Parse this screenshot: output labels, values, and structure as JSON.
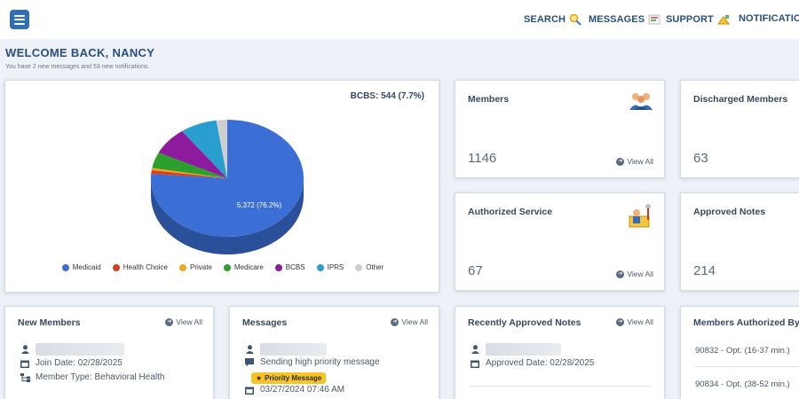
{
  "nav": {
    "search": "SEARCH",
    "messages": "MESSAGES",
    "support": "SUPPORT",
    "notifications": "NOTIFICATION"
  },
  "welcome": {
    "title": "WELCOME BACK, NANCY",
    "subtitle": "You have 2 new messages and 53 new notifications."
  },
  "chart_data": {
    "type": "pie",
    "summary": "BCBS: 544 (7.7%)",
    "slice_label": "5,372 (76.2%)",
    "categories": [
      "Medicaid",
      "Health Choice",
      "Private",
      "Medicare",
      "BCBS",
      "IPRS",
      "Other"
    ],
    "values": [
      76.2,
      1.0,
      0.6,
      4.4,
      7.7,
      7.8,
      2.3
    ],
    "colors": [
      "#3b6fd6",
      "#d9411e",
      "#f5a623",
      "#2ca02c",
      "#8e1a9e",
      "#2a9ecf",
      "#cfcfcf"
    ],
    "legend_position": "bottom"
  },
  "stats": {
    "members": {
      "title": "Members",
      "value": "1146",
      "view_all": "View All",
      "icon": "people-icon"
    },
    "discharged": {
      "title": "Discharged Members",
      "value": "63"
    },
    "authorized": {
      "title": "Authorized Service",
      "value": "67",
      "view_all": "View All",
      "icon": "service-icon"
    },
    "approved": {
      "title": "Approved Notes",
      "value": "214"
    }
  },
  "new_members": {
    "title": "New Members",
    "view_all": "View All",
    "join_date": "Join Date: 02/28/2025",
    "member_type": "Member Type: Behavioral Health"
  },
  "messages_card": {
    "title": "Messages",
    "view_all": "View All",
    "message": "Sending high priority message",
    "badge": "Priority Message",
    "date": "03/27/2024 07:46 AM"
  },
  "recent_notes": {
    "title": "Recently Approved Notes",
    "view_all": "View All",
    "approved_date": "Approved Date: 02/28/2025"
  },
  "members_authorized": {
    "title": "Members Authorized By",
    "items": [
      "90832 - Opt. (16-37 min.)",
      "90834 - Opt. (38-52 min.)"
    ]
  }
}
